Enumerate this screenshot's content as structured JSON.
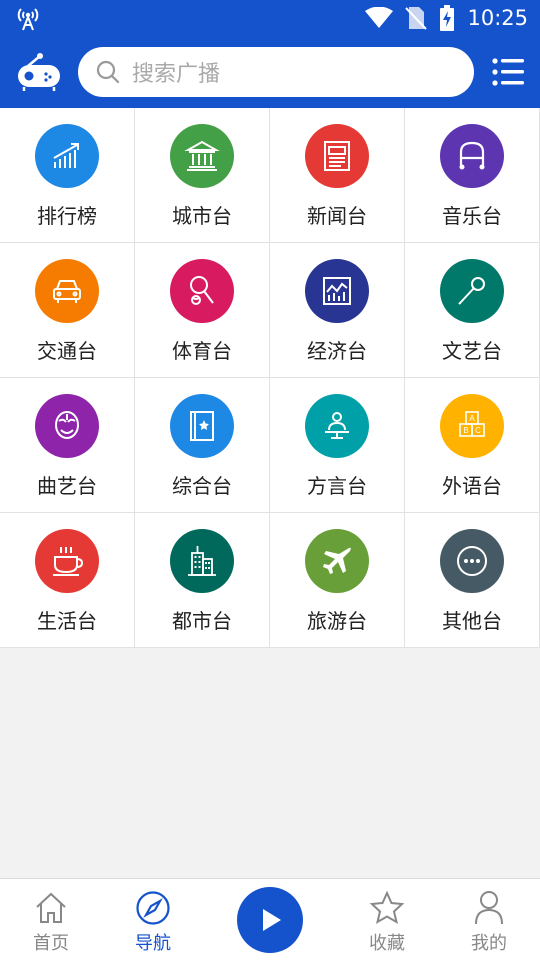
{
  "status_bar": {
    "time": "10:25"
  },
  "search": {
    "placeholder": "搜索广播"
  },
  "categories": [
    {
      "label": "排行榜",
      "icon": "trending-chart-icon",
      "color": "#1e88e5"
    },
    {
      "label": "城市台",
      "icon": "city-hall-icon",
      "color": "#43a047"
    },
    {
      "label": "新闻台",
      "icon": "newspaper-icon",
      "color": "#e53935"
    },
    {
      "label": "音乐台",
      "icon": "headphones-icon",
      "color": "#5e35b1"
    },
    {
      "label": "交通台",
      "icon": "car-icon",
      "color": "#f57c00"
    },
    {
      "label": "体育台",
      "icon": "tennis-icon",
      "color": "#d81b60"
    },
    {
      "label": "经济台",
      "icon": "finance-chart-icon",
      "color": "#283593"
    },
    {
      "label": "文艺台",
      "icon": "microphone-icon",
      "color": "#00796b"
    },
    {
      "label": "曲艺台",
      "icon": "opera-mask-icon",
      "color": "#8e24aa"
    },
    {
      "label": "综合台",
      "icon": "book-icon",
      "color": "#1e88e5"
    },
    {
      "label": "方言台",
      "icon": "speaker-person-icon",
      "color": "#00a0a8"
    },
    {
      "label": "外语台",
      "icon": "abc-blocks-icon",
      "color": "#ffb300"
    },
    {
      "label": "生活台",
      "icon": "coffee-cup-icon",
      "color": "#e53935"
    },
    {
      "label": "都市台",
      "icon": "skyscraper-icon",
      "color": "#00695c"
    },
    {
      "label": "旅游台",
      "icon": "airplane-icon",
      "color": "#689f38"
    },
    {
      "label": "其他台",
      "icon": "more-dots-icon",
      "color": "#455a64"
    }
  ],
  "tabbar": {
    "home": "首页",
    "nav": "导航",
    "favorites": "收藏",
    "mine": "我的",
    "active_tab": "nav"
  },
  "colors": {
    "primary": "#1553cc",
    "tab_inactive": "#888888"
  }
}
